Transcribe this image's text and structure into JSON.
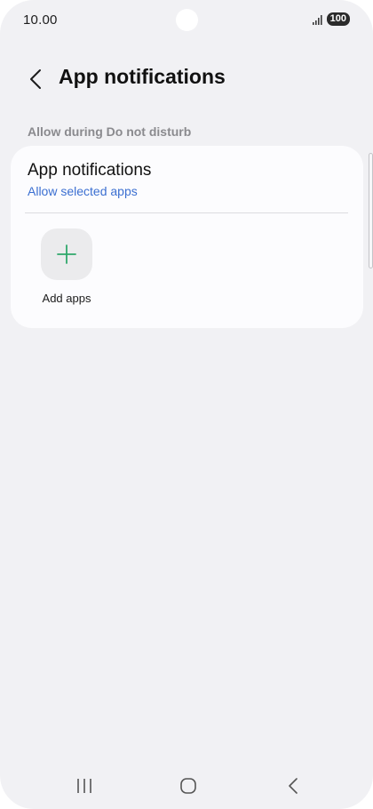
{
  "status_bar": {
    "time": "10.00",
    "battery": "100"
  },
  "header": {
    "title": "App notifications",
    "back_icon": "chevron-left-icon"
  },
  "section": {
    "label": "Allow during Do not disturb"
  },
  "card": {
    "title": "App notifications",
    "subtitle": "Allow selected apps",
    "add_apps_label": "Add apps",
    "add_icon": "plus-icon"
  },
  "nav_bar": {
    "recents_icon": "recents-icon",
    "home_icon": "home-icon",
    "back_icon": "back-icon"
  },
  "colors": {
    "background": "#f1f1f4",
    "card": "#fcfcfe",
    "link_blue": "#3b6fd1",
    "plus_green": "#2fa86b",
    "section_gray": "#8a8a8e"
  }
}
